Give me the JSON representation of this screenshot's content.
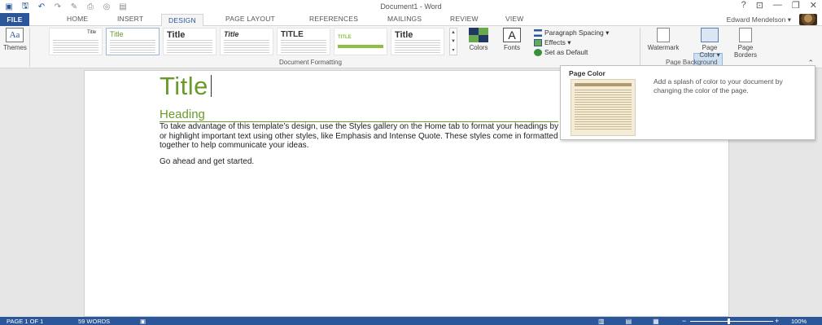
{
  "window": {
    "title": "Document1 - Word",
    "controls": [
      "?",
      "⊡",
      "—",
      "🗗",
      "✕"
    ]
  },
  "quick_access": [
    "save-icon",
    "undo-icon",
    "redo-icon",
    "format-painter-icon",
    "print-preview-icon",
    "touch-mode-icon",
    "layout-icon"
  ],
  "tabs": {
    "file": "FILE",
    "items": [
      "HOME",
      "INSERT",
      "DESIGN",
      "PAGE LAYOUT",
      "REFERENCES",
      "MAILINGS",
      "REVIEW",
      "VIEW"
    ],
    "active": "DESIGN"
  },
  "user": {
    "name": "Edward Mendelson ▾"
  },
  "ribbon": {
    "themes_label": "Themes",
    "gallery": [
      {
        "title": "Title"
      },
      {
        "title": "Title"
      },
      {
        "title": "Title"
      },
      {
        "title": "Title"
      },
      {
        "title": "TITLE"
      },
      {
        "title": "TITLE"
      },
      {
        "title": "Title"
      }
    ],
    "colors_label": "Colors",
    "fonts_label": "Fonts",
    "paragraph_spacing": "Paragraph Spacing ▾",
    "effects": "Effects ▾",
    "set_default": "Set as Default",
    "group_document_formatting": "Document Formatting",
    "watermark_label": "Watermark",
    "page_color_label": "Page Color ▾",
    "page_borders_label": "Page Borders",
    "group_page_background": "Page Background"
  },
  "tooltip": {
    "title": "Page Color",
    "description": "Add a splash of color to your document by changing the color of the page."
  },
  "document": {
    "title": "Title",
    "heading": "Heading",
    "body": "To take advantage of this template’s design, use the Styles gallery on the Home tab to format your headings by using heading styles, or highlight important text using other styles, like Emphasis and Intense Quote. These styles come in formatted to look great and work together to help communicate your ideas.",
    "body2": "Go ahead and get started."
  },
  "status": {
    "page": "PAGE 1 OF 1",
    "words": "59 WORDS",
    "zoom": "100%",
    "zoom_level": 1.0
  },
  "colors": {
    "accent": "#2b579a",
    "title_green": "#6a9a2a"
  }
}
